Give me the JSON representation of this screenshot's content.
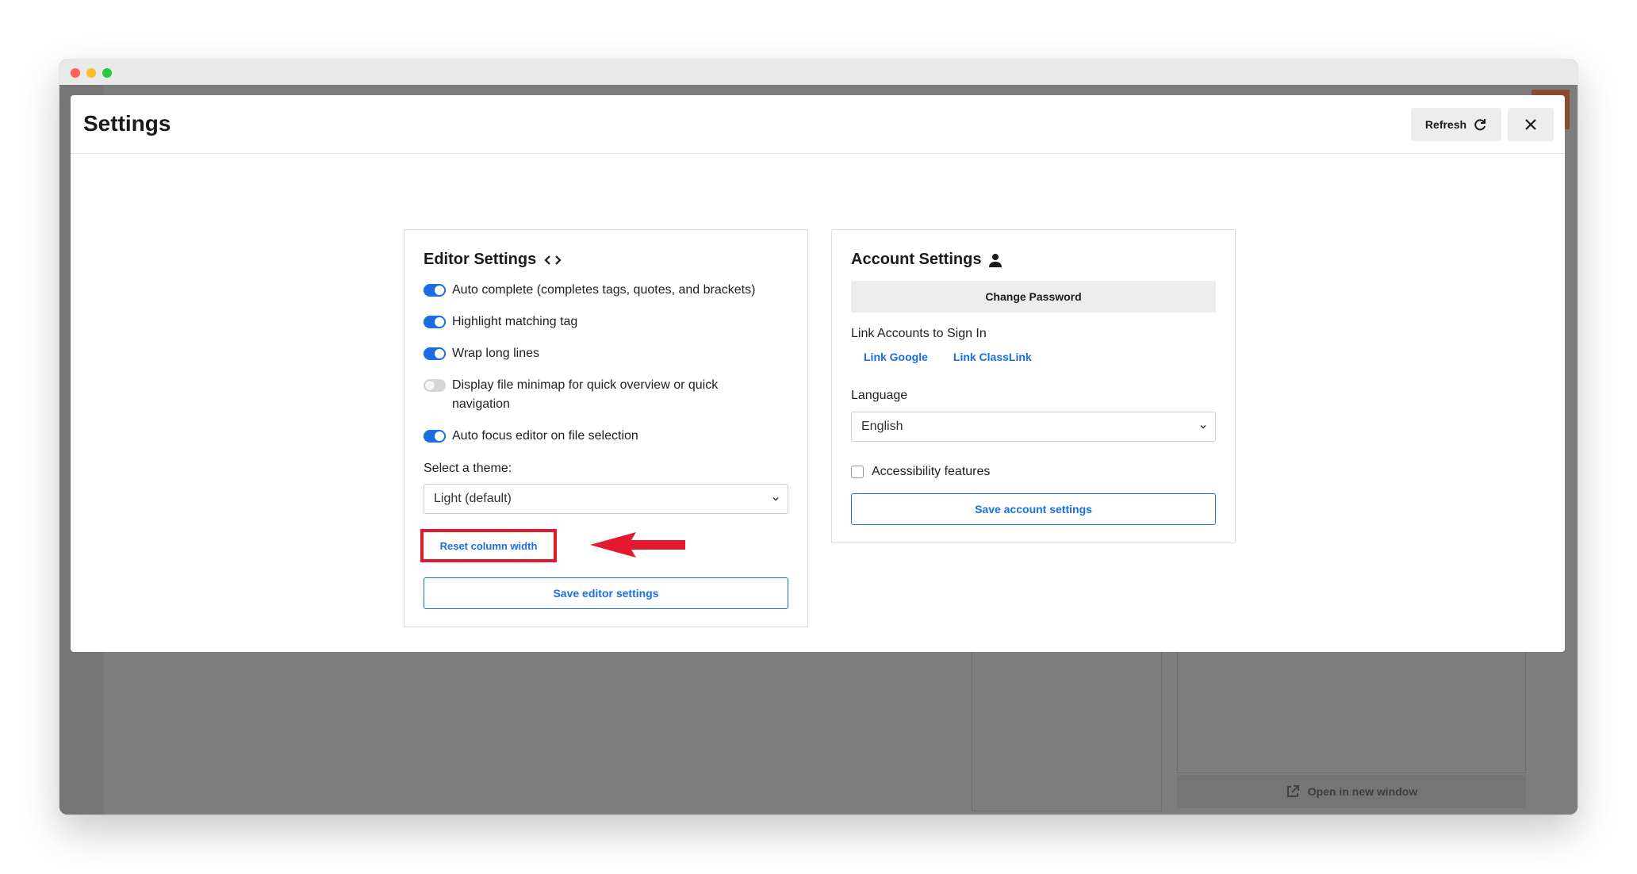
{
  "modal": {
    "title": "Settings",
    "refresh_label": "Refresh"
  },
  "editor_settings": {
    "title": "Editor Settings",
    "toggles": [
      {
        "label": "Auto complete (completes tags, quotes, and brackets)",
        "enabled": true
      },
      {
        "label": "Highlight matching tag",
        "enabled": true
      },
      {
        "label": "Wrap long lines",
        "enabled": true
      },
      {
        "label": "Display file minimap for quick overview or quick navigation",
        "enabled": false
      },
      {
        "label": "Auto focus editor on file selection",
        "enabled": true
      }
    ],
    "theme_label": "Select a theme:",
    "theme_value": "Light (default)",
    "reset_label": "Reset column width",
    "save_label": "Save editor settings"
  },
  "account_settings": {
    "title": "Account Settings",
    "change_password_label": "Change Password",
    "link_accounts_label": "Link Accounts to Sign In",
    "link_google_label": "Link Google",
    "link_classlink_label": "Link ClassLink",
    "language_label": "Language",
    "language_value": "English",
    "accessibility_label": "Accessibility features",
    "accessibility_checked": false,
    "save_label": "Save account settings"
  },
  "background": {
    "open_new_window_label": "Open in new window"
  },
  "colors": {
    "accent": "#1a6fe0",
    "highlight": "#e4182e"
  }
}
